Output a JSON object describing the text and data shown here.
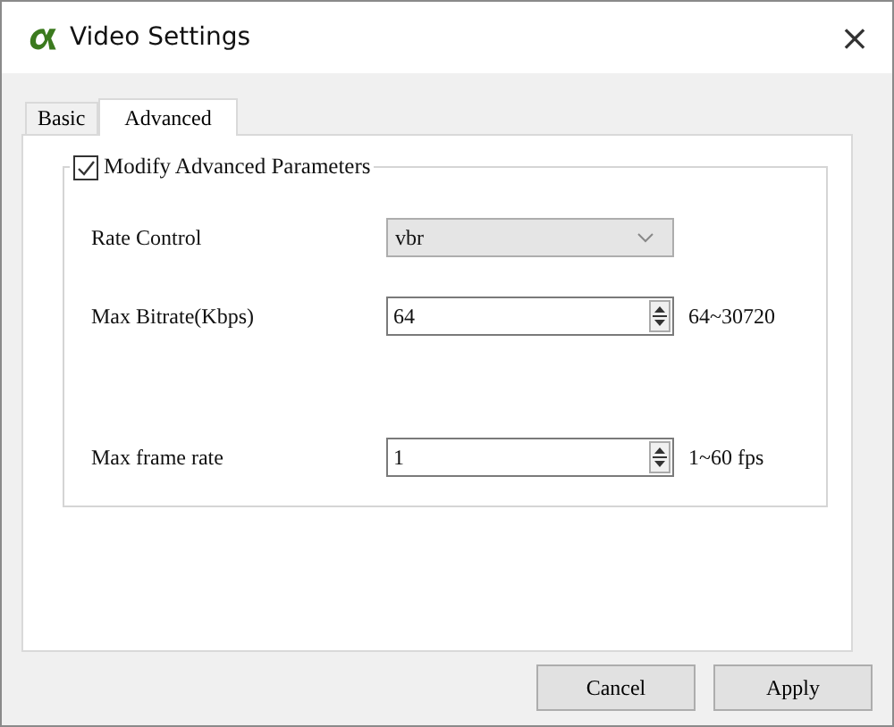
{
  "window": {
    "title": "Video Settings",
    "close": "×"
  },
  "tabs": [
    {
      "label": "Basic",
      "selected": false
    },
    {
      "label": "Advanced",
      "selected": true
    }
  ],
  "group": {
    "label": "Modify Advanced Parameters",
    "checked": true
  },
  "fields": [
    {
      "kind": "select",
      "label": "Rate Control",
      "value": "vbr"
    },
    {
      "kind": "spin",
      "label": "Max Bitrate(Kbps)",
      "value": "64",
      "range": "64~30720"
    },
    {
      "kind": "spin",
      "label": "Max frame rate",
      "value": "1",
      "range": "1~60 fps"
    }
  ],
  "buttons": [
    "Cancel",
    "Apply"
  ]
}
